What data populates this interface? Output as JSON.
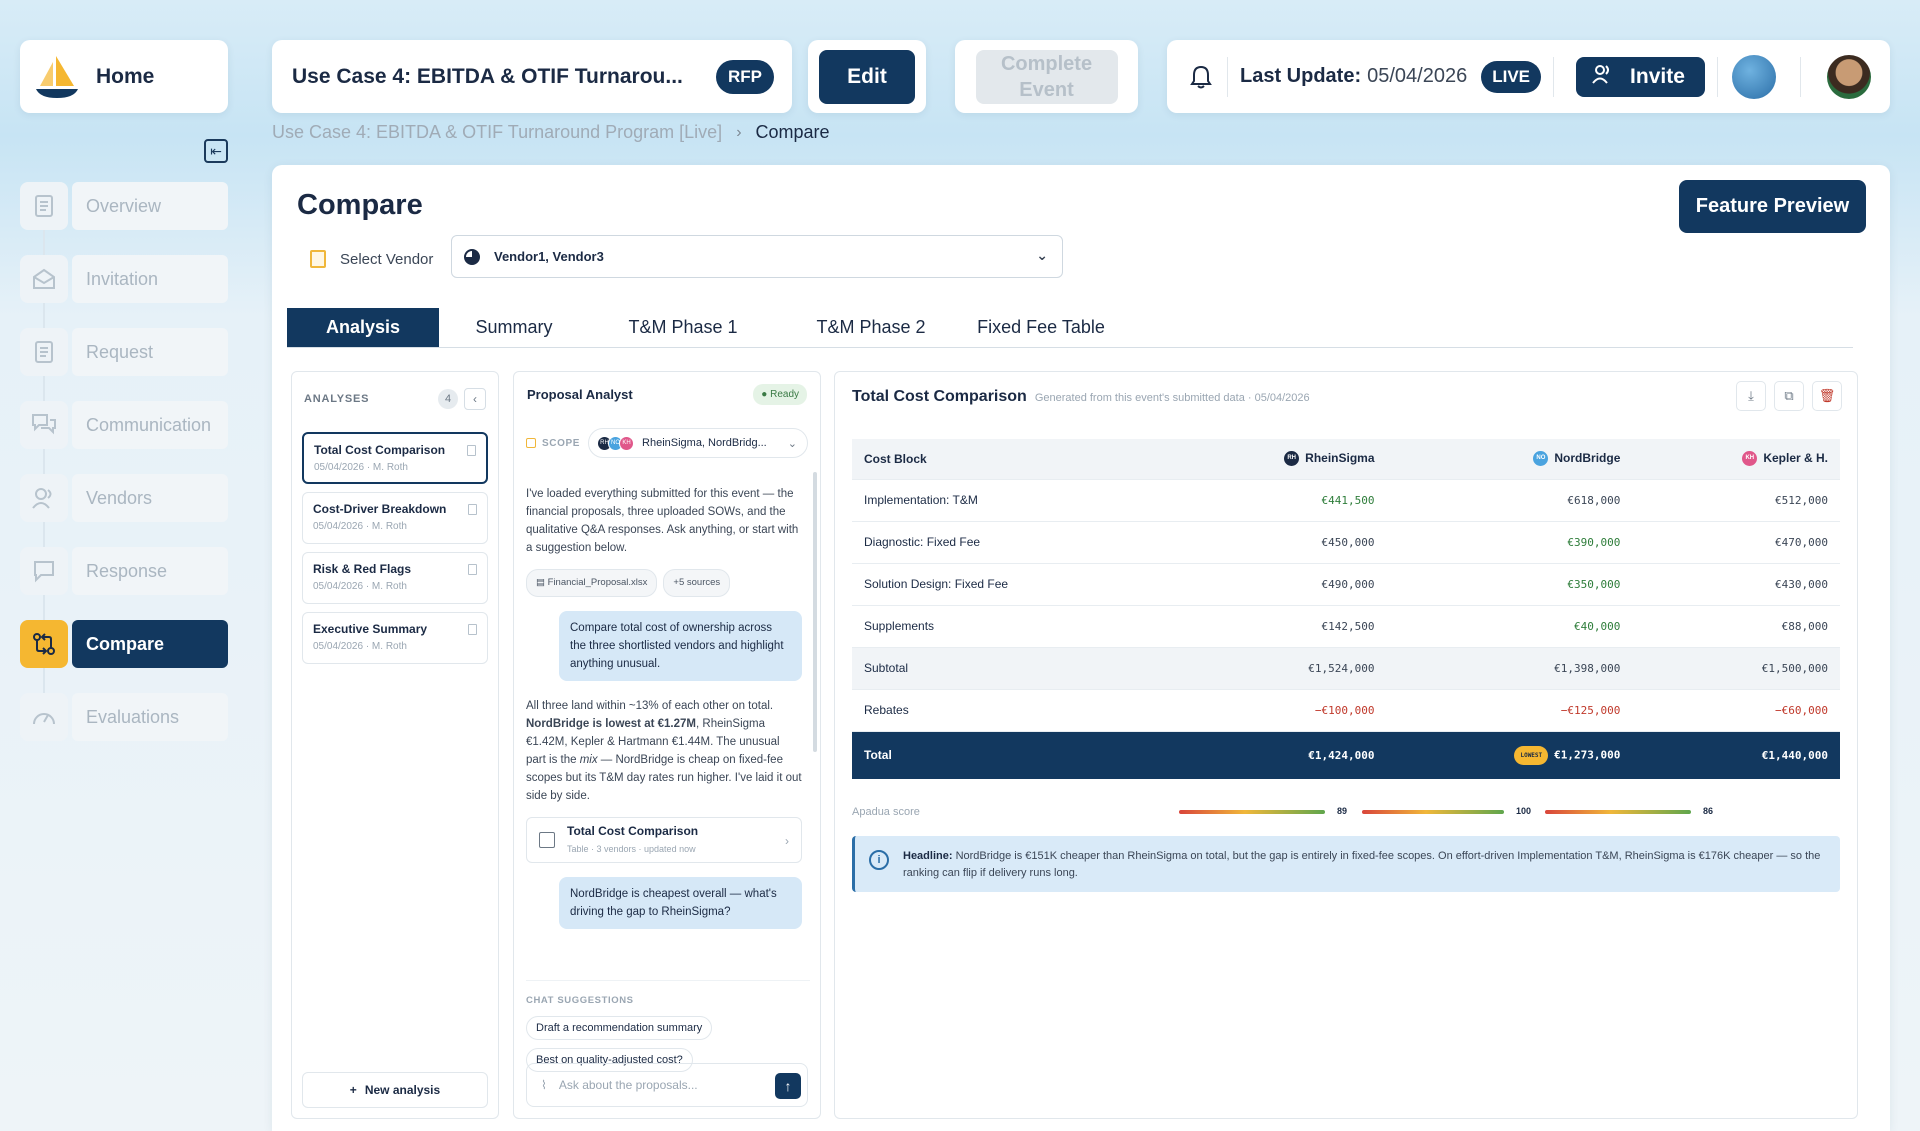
{
  "sidebar": {
    "home_label": "Home",
    "items": [
      {
        "label": "Overview",
        "icon": "document-icon"
      },
      {
        "label": "Invitation",
        "icon": "envelope-icon"
      },
      {
        "label": "Request",
        "icon": "document-icon"
      },
      {
        "label": "Communication",
        "icon": "chat-icon"
      },
      {
        "label": "Vendors",
        "icon": "users-icon"
      },
      {
        "label": "Response",
        "icon": "message-icon"
      },
      {
        "label": "Compare",
        "icon": "compare-icon",
        "active": true
      },
      {
        "label": "Evaluations",
        "icon": "gauge-icon"
      }
    ]
  },
  "header": {
    "title": "Use Case 4: EBITDA & OTIF Turnarou...",
    "rfp_badge": "RFP",
    "edit_label": "Edit",
    "complete_label": "Complete Event",
    "last_update_label": "Last Update:",
    "last_update_date": "05/04/2026",
    "live_badge": "LIVE",
    "invite_label": "Invite"
  },
  "breadcrumb": {
    "parent": "Use Case 4: EBITDA & OTIF Turnaround Program [Live]",
    "current": "Compare"
  },
  "page": {
    "title": "Compare",
    "feature_preview_label": "Feature Preview",
    "select_vendor_label": "Select Vendor",
    "selected_vendors": "Vendor1, Vendor3"
  },
  "tabs": [
    "Analysis",
    "Summary",
    "T&M Phase 1",
    "T&M Phase 2",
    "Fixed Fee Table"
  ],
  "analyses": {
    "header": "ANALYSES",
    "count": "4",
    "items": [
      {
        "name": "Total Cost Comparison",
        "meta": "05/04/2026 · M. Roth"
      },
      {
        "name": "Cost-Driver Breakdown",
        "meta": "05/04/2026 · M. Roth"
      },
      {
        "name": "Risk & Red Flags",
        "meta": "05/04/2026 · M. Roth"
      },
      {
        "name": "Executive Summary",
        "meta": "05/04/2026 · M. Roth"
      }
    ],
    "new_label": "New analysis"
  },
  "chat": {
    "title": "Proposal Analyst",
    "status": "Ready",
    "scope_label": "SCOPE",
    "scope_value": "RheinSigma, NordBridg...",
    "intro": "I've loaded everything submitted for this event — the financial proposals, three uploaded SOWs, and the qualitative Q&A responses. Ask anything, or start with a suggestion below.",
    "chip_file": "Financial_Proposal.xlsx",
    "chip_more": "+5 sources",
    "user_msg_1": "Compare total cost of ownership across the three shortlisted vendors and highlight anything unusual.",
    "answer_pre": "All three land within ~13% of each other on total. ",
    "answer_bold": "NordBridge is lowest at €1.27M",
    "answer_mid": ", RheinSigma €1.42M, Kepler & Hartmann €1.44M. The unusual part is the ",
    "answer_em": "mix",
    "answer_post": " — NordBridge is cheap on fixed-fee scopes but its T&M day rates run higher. I've laid it out side by side.",
    "card_title": "Total Cost Comparison",
    "card_sub": "Table · 3 vendors · updated now",
    "user_msg_2": "NordBridge is cheapest overall — what's driving the gap to RheinSigma?",
    "suggestions_label": "CHAT SUGGESTIONS",
    "suggestions": [
      "Draft a recommendation summary",
      "Best on quality-adjusted cost?"
    ],
    "input_placeholder": "Ask about the proposals..."
  },
  "comparison": {
    "title": "Total Cost Comparison",
    "generated": "Generated from this event's submitted data · 05/04/2026",
    "columns": [
      "Cost Block",
      "RheinSigma",
      "NordBridge",
      "Kepler & H."
    ],
    "vendor_initials": [
      "RH",
      "NO",
      "KH"
    ],
    "vendor_colors": [
      "#1b2a44",
      "#4aa3df",
      "#e0578a"
    ],
    "rows": [
      {
        "label": "Implementation: T&M",
        "values": [
          "€441,500",
          "€618,000",
          "€512,000"
        ],
        "tones": [
          "green",
          "",
          ""
        ]
      },
      {
        "label": "Diagnostic: Fixed Fee",
        "values": [
          "€450,000",
          "€390,000",
          "€470,000"
        ],
        "tones": [
          "",
          "green",
          ""
        ]
      },
      {
        "label": "Solution Design: Fixed Fee",
        "values": [
          "€490,000",
          "€350,000",
          "€430,000"
        ],
        "tones": [
          "",
          "green",
          ""
        ]
      },
      {
        "label": "Supplements",
        "values": [
          "€142,500",
          "€40,000",
          "€88,000"
        ],
        "tones": [
          "",
          "green",
          ""
        ]
      },
      {
        "label": "Subtotal",
        "values": [
          "€1,524,000",
          "€1,398,000",
          "€1,500,000"
        ],
        "tones": [
          "",
          "",
          ""
        ],
        "style": "sub"
      },
      {
        "label": "Rebates",
        "values": [
          "−€100,000",
          "−€125,000",
          "−€60,000"
        ],
        "tones": [
          "red",
          "red",
          "red"
        ]
      },
      {
        "label": "Total",
        "values": [
          "€1,424,000",
          "€1,273,000",
          "€1,440,000"
        ],
        "tones": [
          "",
          "",
          ""
        ],
        "style": "total"
      }
    ],
    "lowest_badge": "LOWEST",
    "score_label": "Apadua score",
    "scores": [
      89,
      100,
      86
    ],
    "headline_label": "Headline:",
    "headline_text": "NordBridge is €151K cheaper than RheinSigma on total, but the gap is entirely in fixed-fee scopes. On effort-driven Implementation T&M, RheinSigma is €176K cheaper — so the ranking can flip if delivery runs long."
  }
}
